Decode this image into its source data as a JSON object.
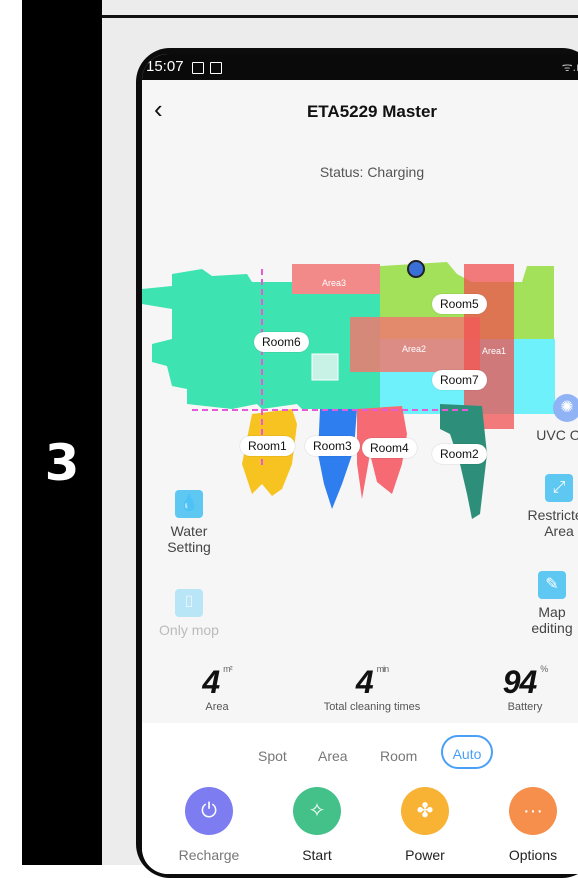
{
  "step_number": "3",
  "status_bar": {
    "time": "15:07"
  },
  "header": {
    "title": "ETA5229 Master"
  },
  "status_text": "Status: Charging",
  "map": {
    "rooms": [
      "Room5",
      "Room6",
      "Room7",
      "Room1",
      "Room3",
      "Room4",
      "Room2"
    ],
    "areas": [
      "Area3",
      "Area2",
      "Area1"
    ]
  },
  "side_controls": {
    "uvc": "UVC OFF",
    "restricted_area": [
      "Restricted",
      "Area"
    ],
    "map_editing": [
      "Map",
      "editing"
    ],
    "water_setting": [
      "Water",
      "Setting"
    ],
    "only_mop": "Only mop"
  },
  "stats": {
    "area": {
      "value": "4",
      "unit": "m²",
      "label": "Area"
    },
    "time": {
      "value": "4",
      "unit": "min",
      "label": "Total cleaning times"
    },
    "battery": {
      "value": "94",
      "unit": "%",
      "label": "Battery"
    }
  },
  "modes": {
    "spot": "Spot",
    "area": "Area",
    "room": "Room",
    "auto": "Auto",
    "selected": "Auto"
  },
  "actions": {
    "recharge": "Recharge",
    "start": "Start",
    "power": "Power",
    "options": "Options"
  },
  "colors": {
    "room_green": "#3de3b0",
    "room_lime": "#a3e15a",
    "room_cyan": "#6ff1fb",
    "room_red": "#f56a73",
    "room_blue": "#2f7ef0",
    "room_yellow": "#f7c321",
    "room_teal": "#2d8f7a",
    "accent_blue": "#4a9ff7",
    "recharge_purple": "#7d7cf0",
    "start_green": "#43c189",
    "power_orange": "#f8b234",
    "options_orange": "#f58f4b"
  }
}
